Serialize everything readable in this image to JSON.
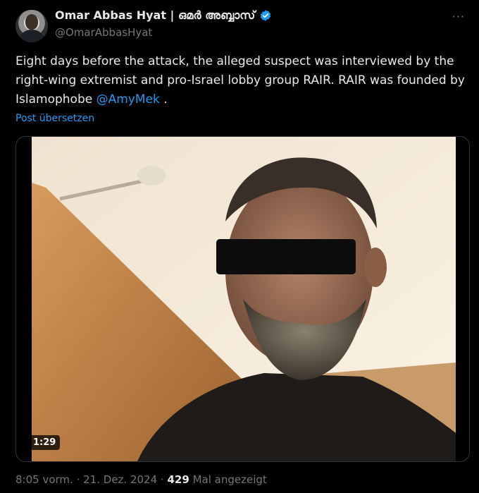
{
  "author": {
    "display_name": "Omar Abbas Hyat | ഒമർ അബ്ബാസ്",
    "handle": "@OmarAbbasHyat",
    "verified": true
  },
  "tweet": {
    "text_part1": "Eight days before the attack, the alleged suspect was interviewed by the right-wing extremist and pro-Israel lobby group RAIR. RAIR was founded by Islamophobe ",
    "mention": "@AmyMek",
    "text_part2": " .",
    "translate_label": "Post übersetzen"
  },
  "media": {
    "duration": "1:29"
  },
  "footer": {
    "time": "8:05 vorm.",
    "separator": "·",
    "date": "21. Dez. 2024",
    "views_count": "429",
    "views_label": "Mal angezeigt"
  },
  "more_icon": "ellipsis-icon",
  "colors": {
    "background": "#000000",
    "accent": "#1d9bf0",
    "muted": "#71767b",
    "text": "#e7e9ea"
  }
}
